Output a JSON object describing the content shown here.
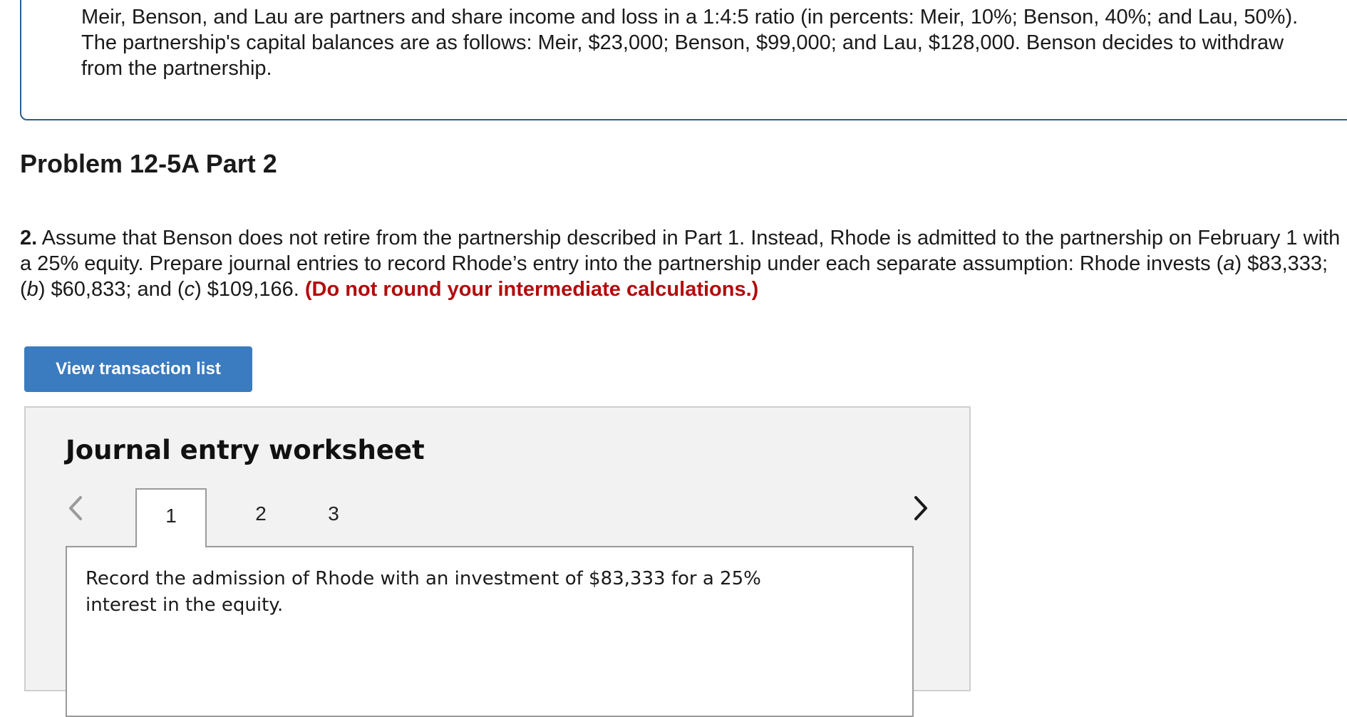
{
  "intro": {
    "text": "Meir, Benson, and Lau are partners and share income and loss in a 1:4:5 ratio (in percents: Meir, 10%; Benson, 40%; and Lau, 50%). The partnership's capital balances are as follows: Meir, $23,000; Benson, $99,000; and Lau, $128,000. Benson decides to withdraw from the partnership."
  },
  "problem": {
    "title": "Problem 12-5A Part 2"
  },
  "question": {
    "number": "2.",
    "text_1": " Assume that Benson does not retire from the partnership described in Part 1. Instead, Rhode is admitted to the partnership on February 1 with a 25% equity. Prepare journal entries to record Rhode’s entry into the partnership under each separate assumption: Rhode invests (",
    "a": "a",
    "text_2": ") $83,333; (",
    "b": "b",
    "text_3": ") $60,833; and (",
    "c": "c",
    "text_4": ") $109,166. ",
    "note": "(Do not round your intermediate calculations.)"
  },
  "buttons": {
    "view_transactions": "View transaction list"
  },
  "worksheet": {
    "title": "Journal entry worksheet",
    "tabs": [
      "1",
      "2",
      "3"
    ],
    "active_tab": "1",
    "instruction": "Record the admission of Rhode with an investment of $83,333 for a 25% interest in the equity."
  },
  "colors": {
    "accent_blue": "#3b7bbf",
    "note_red": "#b20c0c",
    "frame_blue": "#2b5f8e"
  }
}
